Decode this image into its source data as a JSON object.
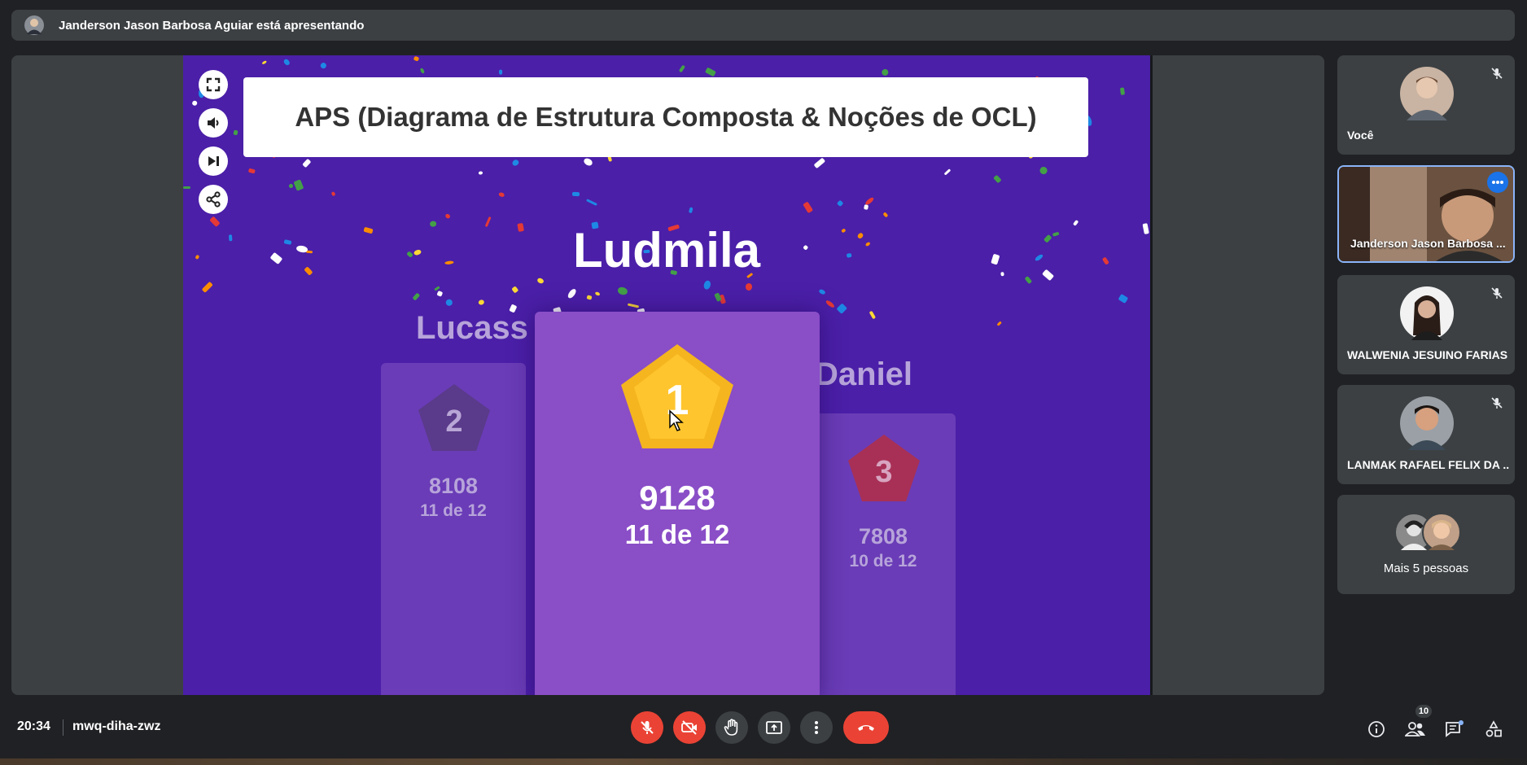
{
  "banner": {
    "presenting_text": "Janderson Jason Barbosa Aguiar está apresentando"
  },
  "slide": {
    "title": "APS (Diagrama de Estrutura Composta & Noções de OCL)",
    "winner": "Ludmila",
    "podium": {
      "first": {
        "rank": "1",
        "score": "9128",
        "correct": "11 de 12"
      },
      "second": {
        "rank": "2",
        "name": "Lucass",
        "score": "8108",
        "correct": "11 de 12"
      },
      "third": {
        "rank": "3",
        "name": "Daniel",
        "score": "7808",
        "correct": "10 de 12"
      }
    },
    "controls": [
      "fullscreen-icon",
      "volume-icon",
      "skip-next-icon",
      "share-icon"
    ]
  },
  "participants": [
    {
      "name": "Você",
      "muted": true
    },
    {
      "name": "Janderson Jason Barbosa ...",
      "active_speaker": true
    },
    {
      "name": "WALWENIA JESUINO FARIAS",
      "muted": true
    },
    {
      "name": "LANMAK RAFAEL FELIX DA ...",
      "muted": true
    }
  ],
  "more_people": {
    "label": "Mais 5 pessoas"
  },
  "bottom": {
    "time": "20:34",
    "meeting_code": "mwq-diha-zwz",
    "participant_count": "10"
  },
  "colors": {
    "background": "#202124",
    "tile": "#3c4043",
    "slide_purple": "#4b1fa8",
    "danger": "#ea4335",
    "accent": "#8ab4f8"
  }
}
